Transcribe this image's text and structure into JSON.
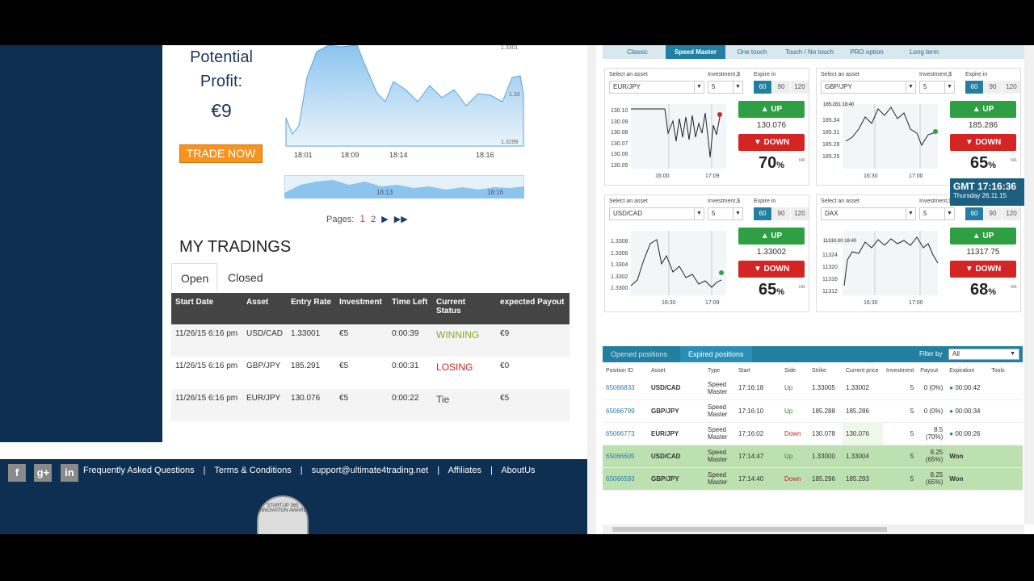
{
  "left": {
    "profit_label_1": "Potential",
    "profit_label_2": "Profit:",
    "profit_value": "€9",
    "trade_now": "TRADE NOW",
    "mini_chart": {
      "x_ticks": [
        "18:01",
        "18:09",
        "18:14",
        "18:16"
      ],
      "y_ticks": [
        "1.3301",
        "1.33",
        "1.3299"
      ],
      "nav_ticks": [
        "18:13",
        "18:16"
      ]
    },
    "pager": {
      "label": "Pages:",
      "p1": "1",
      "p2": "2"
    },
    "my_tradings": "MY TRADINGS",
    "tabs": {
      "open": "Open",
      "closed": "Closed"
    },
    "table": {
      "headers": [
        "Start Date",
        "Asset",
        "Entry Rate",
        "Investment",
        "Time Left",
        "Current Status",
        "expected Payout"
      ],
      "rows": [
        {
          "date": "11/26/15 6:16 pm",
          "asset": "USD/CAD",
          "rate": "1.33001",
          "inv": "€5",
          "left": "0:00:39",
          "status": "WINNING",
          "payout": "€9"
        },
        {
          "date": "11/26/15 6:16 pm",
          "asset": "GBP/JPY",
          "rate": "185.291",
          "inv": "€5",
          "left": "0:00:31",
          "status": "LOSING",
          "payout": "€0"
        },
        {
          "date": "11/26/15 6:16 pm",
          "asset": "EUR/JPY",
          "rate": "130.076",
          "inv": "€5",
          "left": "0:00:22",
          "status": "Tie",
          "payout": "€5"
        }
      ]
    },
    "footer": {
      "social": [
        "f",
        "g+",
        "in"
      ],
      "links": [
        "Frequently Asked Questions",
        "|",
        "Terms & Conditions",
        "|",
        "support@ultimate4trading.net",
        "|",
        "Affiliates",
        "|",
        "AboutUs"
      ],
      "award": "STARTUP 365 INNOVATION AWARD"
    }
  },
  "right": {
    "modes": [
      "Classic",
      "Speed Master",
      "One touch",
      "Touch / No touch",
      "PRO option",
      "Long term"
    ],
    "labels": {
      "asset": "Select an asset",
      "investment": "Investment,$",
      "expire": "Expire in",
      "up": "UP",
      "down": "DOWN",
      "ret": "ret."
    },
    "widgets": [
      {
        "asset": "EUR/JPY",
        "inv": "5",
        "exp": [
          "60",
          "90",
          "120"
        ],
        "rate": "130.076",
        "pct": "70",
        "y_ticks": [
          "130.10",
          "130.09",
          "130.08",
          "130.07",
          "130.06",
          "130.05"
        ],
        "x_ticks": [
          "16:00",
          "17:09"
        ],
        "tag": ""
      },
      {
        "asset": "GBP/JPY",
        "inv": "5",
        "exp": [
          "60",
          "90",
          "120"
        ],
        "rate": "185.286",
        "pct": "65",
        "y_ticks": [
          "185.34",
          "185.31",
          "185.28",
          "185.25"
        ],
        "x_ticks": [
          "16:30",
          "17:00"
        ],
        "tag": "185.281 18:40"
      },
      {
        "asset": "USD/CAD",
        "inv": "5",
        "exp": [
          "60",
          "90",
          "120"
        ],
        "rate": "1.33002",
        "pct": "65",
        "y_ticks": [
          "1.3308",
          "1.3306",
          "1.3304",
          "1.3302",
          "1.3300"
        ],
        "x_ticks": [
          "16:30",
          "17:09"
        ],
        "tag": ""
      },
      {
        "asset": "DAX",
        "inv": "5",
        "exp": [
          "60",
          "90",
          "120"
        ],
        "rate": "11317.75",
        "pct": "68",
        "y_ticks": [
          "11324",
          "11320",
          "11316",
          "11312"
        ],
        "x_ticks": [
          "16:30",
          "17:00"
        ],
        "tag": "11310.00 16:40"
      }
    ],
    "clock": {
      "prefix": "GMT",
      "time": "17:16:36",
      "date": "Thursday 26.11.15"
    },
    "positions": {
      "tab_opened": "Opened positions",
      "tab_expired": "Expired positions",
      "filter_label": "Filter by",
      "filter_value": "All",
      "headers": [
        "Position ID",
        "Asset",
        "Type",
        "Start",
        "Side",
        "Strike",
        "Current price",
        "Investment",
        "Payout",
        "Expiration",
        "Tools"
      ],
      "rows": [
        {
          "id": "65066833",
          "asset": "USD/CAD",
          "type": "Speed Master",
          "start": "17:16:18",
          "side": "Up",
          "strike": "1.33005",
          "cur": "1.33002",
          "inv": "5",
          "payout": "0 (0%)",
          "exp": "00:00:42",
          "won": false
        },
        {
          "id": "65066799",
          "asset": "GBP/JPY",
          "type": "Speed Master",
          "start": "17:16:10",
          "side": "Up",
          "strike": "185.288",
          "cur": "185.286",
          "inv": "5",
          "payout": "0 (0%)",
          "exp": "00:00:34",
          "won": false
        },
        {
          "id": "65066773",
          "asset": "EUR/JPY",
          "type": "Speed Master",
          "start": "17:16:02",
          "side": "Down",
          "strike": "130.078",
          "cur": "130.076",
          "inv": "5",
          "payout": "8.5 (70%)",
          "exp": "00:00:26",
          "won": false
        },
        {
          "id": "65066605",
          "asset": "USD/CAD",
          "type": "Speed Master",
          "start": "17:14:47",
          "side": "Up",
          "strike": "1.33000",
          "cur": "1.33004",
          "inv": "5",
          "payout": "8.25 (65%)",
          "exp": "Won",
          "won": true
        },
        {
          "id": "65066593",
          "asset": "GBP/JPY",
          "type": "Speed Master",
          "start": "17:14:40",
          "side": "Down",
          "strike": "185.296",
          "cur": "185.293",
          "inv": "5",
          "payout": "8.25 (65%)",
          "exp": "Won",
          "won": true
        }
      ]
    }
  }
}
